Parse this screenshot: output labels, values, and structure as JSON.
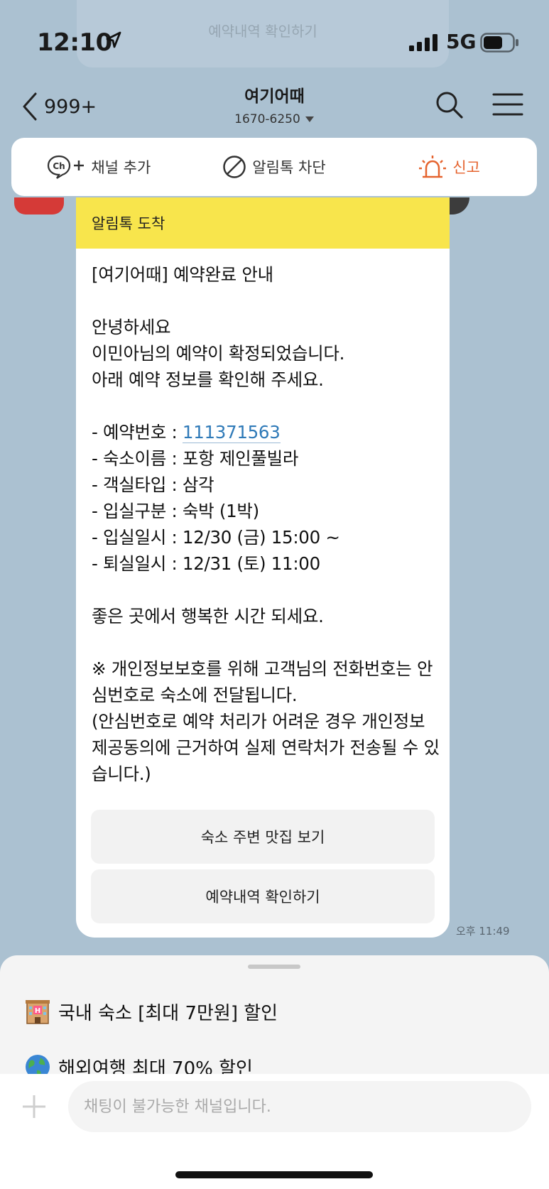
{
  "status_bar": {
    "time": "12:10",
    "network": "5G"
  },
  "ghost": {
    "button_label": "예약내역 확인하기"
  },
  "header": {
    "back_count": "999+",
    "channel_name": "여기어때",
    "channel_phone": "1670-6250"
  },
  "actions": {
    "add_channel": "채널 추가",
    "block": "알림톡 차단",
    "report": "신고"
  },
  "message": {
    "header": "알림톡 도착",
    "title": "[여기어때] 예약완료 안내",
    "greeting": "안녕하세요",
    "confirmed": "이민아님의 예약이 확정되었습니다.",
    "check_info": "아래 예약 정보를 확인해 주세요.",
    "booking_number_label": "- 예약번호 : ",
    "booking_number": "111371563",
    "lodging": "- 숙소이름 : 포항 제인풀빌라",
    "room_type": "- 객실타입 : 삼각",
    "stay_type": "- 입실구분 : 숙박 (1박)",
    "checkin": "- 입실일시 : 12/30 (금) 15:00 ~",
    "checkout": "- 퇴실일시 : 12/31 (토) 11:00",
    "closing": "좋은 곳에서 행복한 시간 되세요.",
    "notice_lines": [
      "※ 개인정보보호를 위해 고객님의 전화번호는 안",
      "심번호로 숙소에 전달됩니다.",
      "(안심번호로 예약 처리가 어려운 경우 개인정보",
      "제공동의에 근거하여 실제 연락처가 전송될 수 있",
      "습니다.)"
    ],
    "button_restaurants": "숙소 주변 맛집 보기",
    "button_reservations": "예약내역 확인하기",
    "time": "오후 11:49"
  },
  "promos": [
    {
      "icon": "hotel-icon",
      "label": "국내 숙소 [최대 7만원] 할인"
    },
    {
      "icon": "globe-icon",
      "label": "해외여행 최대 70% 할인"
    }
  ],
  "input": {
    "placeholder": "채팅이 불가능한 채널입니다."
  },
  "colors": {
    "background": "#abc1d1",
    "notice_header": "#f8e54c",
    "report": "#e5632e",
    "link": "#2f7ab8"
  }
}
